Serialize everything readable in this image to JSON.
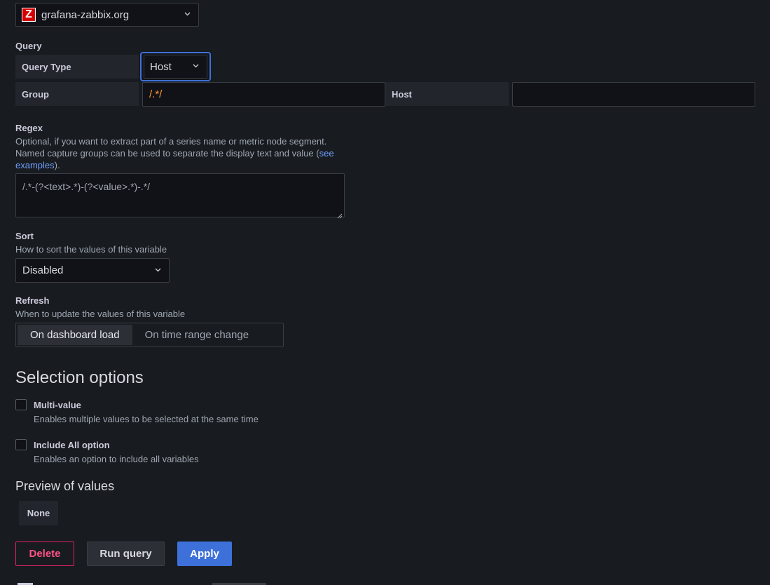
{
  "datasource": {
    "name": "grafana-zabbix.org",
    "logo_letter": "Z",
    "logo_color": "#d40000"
  },
  "query": {
    "section_label": "Query",
    "query_type_label": "Query Type",
    "query_type_value": "Host",
    "group_label": "Group",
    "group_value": "/.*/",
    "host_label": "Host",
    "host_value": ""
  },
  "regex": {
    "label": "Regex",
    "desc_line1": "Optional, if you want to extract part of a series name or metric node segment.",
    "desc_line2_prefix": "Named capture groups can be used to separate the display text and value (",
    "desc_link_part1": "see",
    "desc_link_part2": "examples",
    "desc_suffix": ").",
    "placeholder": "/.*-(?<text>.*)-(?<value>.*)-.*/"
  },
  "sort": {
    "label": "Sort",
    "desc": "How to sort the values of this variable",
    "value": "Disabled"
  },
  "refresh": {
    "label": "Refresh",
    "desc": "When to update the values of this variable",
    "options": [
      "On dashboard load",
      "On time range change"
    ],
    "selected": "On dashboard load"
  },
  "selection": {
    "title": "Selection options",
    "multi_value": {
      "label": "Multi-value",
      "desc": "Enables multiple values to be selected at the same time",
      "checked": false
    },
    "include_all": {
      "label": "Include All option",
      "desc": "Enables an option to include all variables",
      "checked": false
    }
  },
  "preview": {
    "title": "Preview of values",
    "values": [
      "None"
    ]
  },
  "buttons": {
    "delete": "Delete",
    "run_query": "Run query",
    "apply": "Apply"
  },
  "colors": {
    "accent": "#3d71d9",
    "danger": "#e0226e",
    "regex_value": "#ff9830",
    "link": "#6e9fff"
  }
}
